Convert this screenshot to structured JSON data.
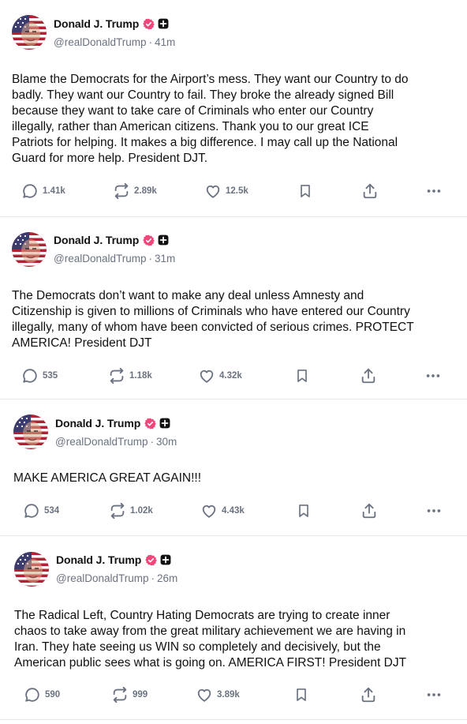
{
  "author": {
    "name": "Donald J. Trump",
    "handle": "@realDonaldTrump"
  },
  "colors": {
    "verified": "#f0467a",
    "text": "#111111",
    "muted": "#6b7280",
    "separator": "#e5e7eb"
  },
  "icons": {
    "reply": "reply-icon",
    "repost": "repost-icon",
    "like": "heart-icon",
    "bookmark": "bookmark-icon",
    "share": "share-icon",
    "more": "more-icon"
  },
  "posts": [
    {
      "time": "41m",
      "text": "Blame the Democrats for the Airport’s mess. They want our Country to do\nbadly. They want our Country to fail. They broke the already signed Bill\nbecause they want to take care of Criminals who enter our Country\nillegally, rather than American citizens. Thank you to our great ICE\nPatriots for helping. It makes a big difference. I may call up the National\nGuard for more help. President DJT.",
      "replies": "1.41k",
      "reposts": "2.89k",
      "likes": "12.5k"
    },
    {
      "time": "31m",
      "text": "The Democrats don’t want to make any deal unless Amnesty and\nCitizenship is given to millions of Criminals who have entered our Country\nillegally, many of whom have been convicted of serious crimes. PROTECT\nAMERICA! President DJT",
      "replies": "535",
      "reposts": "1.18k",
      "likes": "4.32k"
    },
    {
      "time": "30m",
      "text": "MAKE AMERICA GREAT AGAIN!!!",
      "replies": "534",
      "reposts": "1.02k",
      "likes": "4.43k"
    },
    {
      "time": "26m",
      "text": "The Radical Left, Country Hating Democrats are trying to create inner\nchaos to take away from the great military achievement we are having in\nIran. They hate seeing us WIN so completely and decisively, but the\nAmerican public sees what is going on. AMERICA FIRST! President DJT",
      "replies": "590",
      "reposts": "999",
      "likes": "3.89k"
    }
  ]
}
